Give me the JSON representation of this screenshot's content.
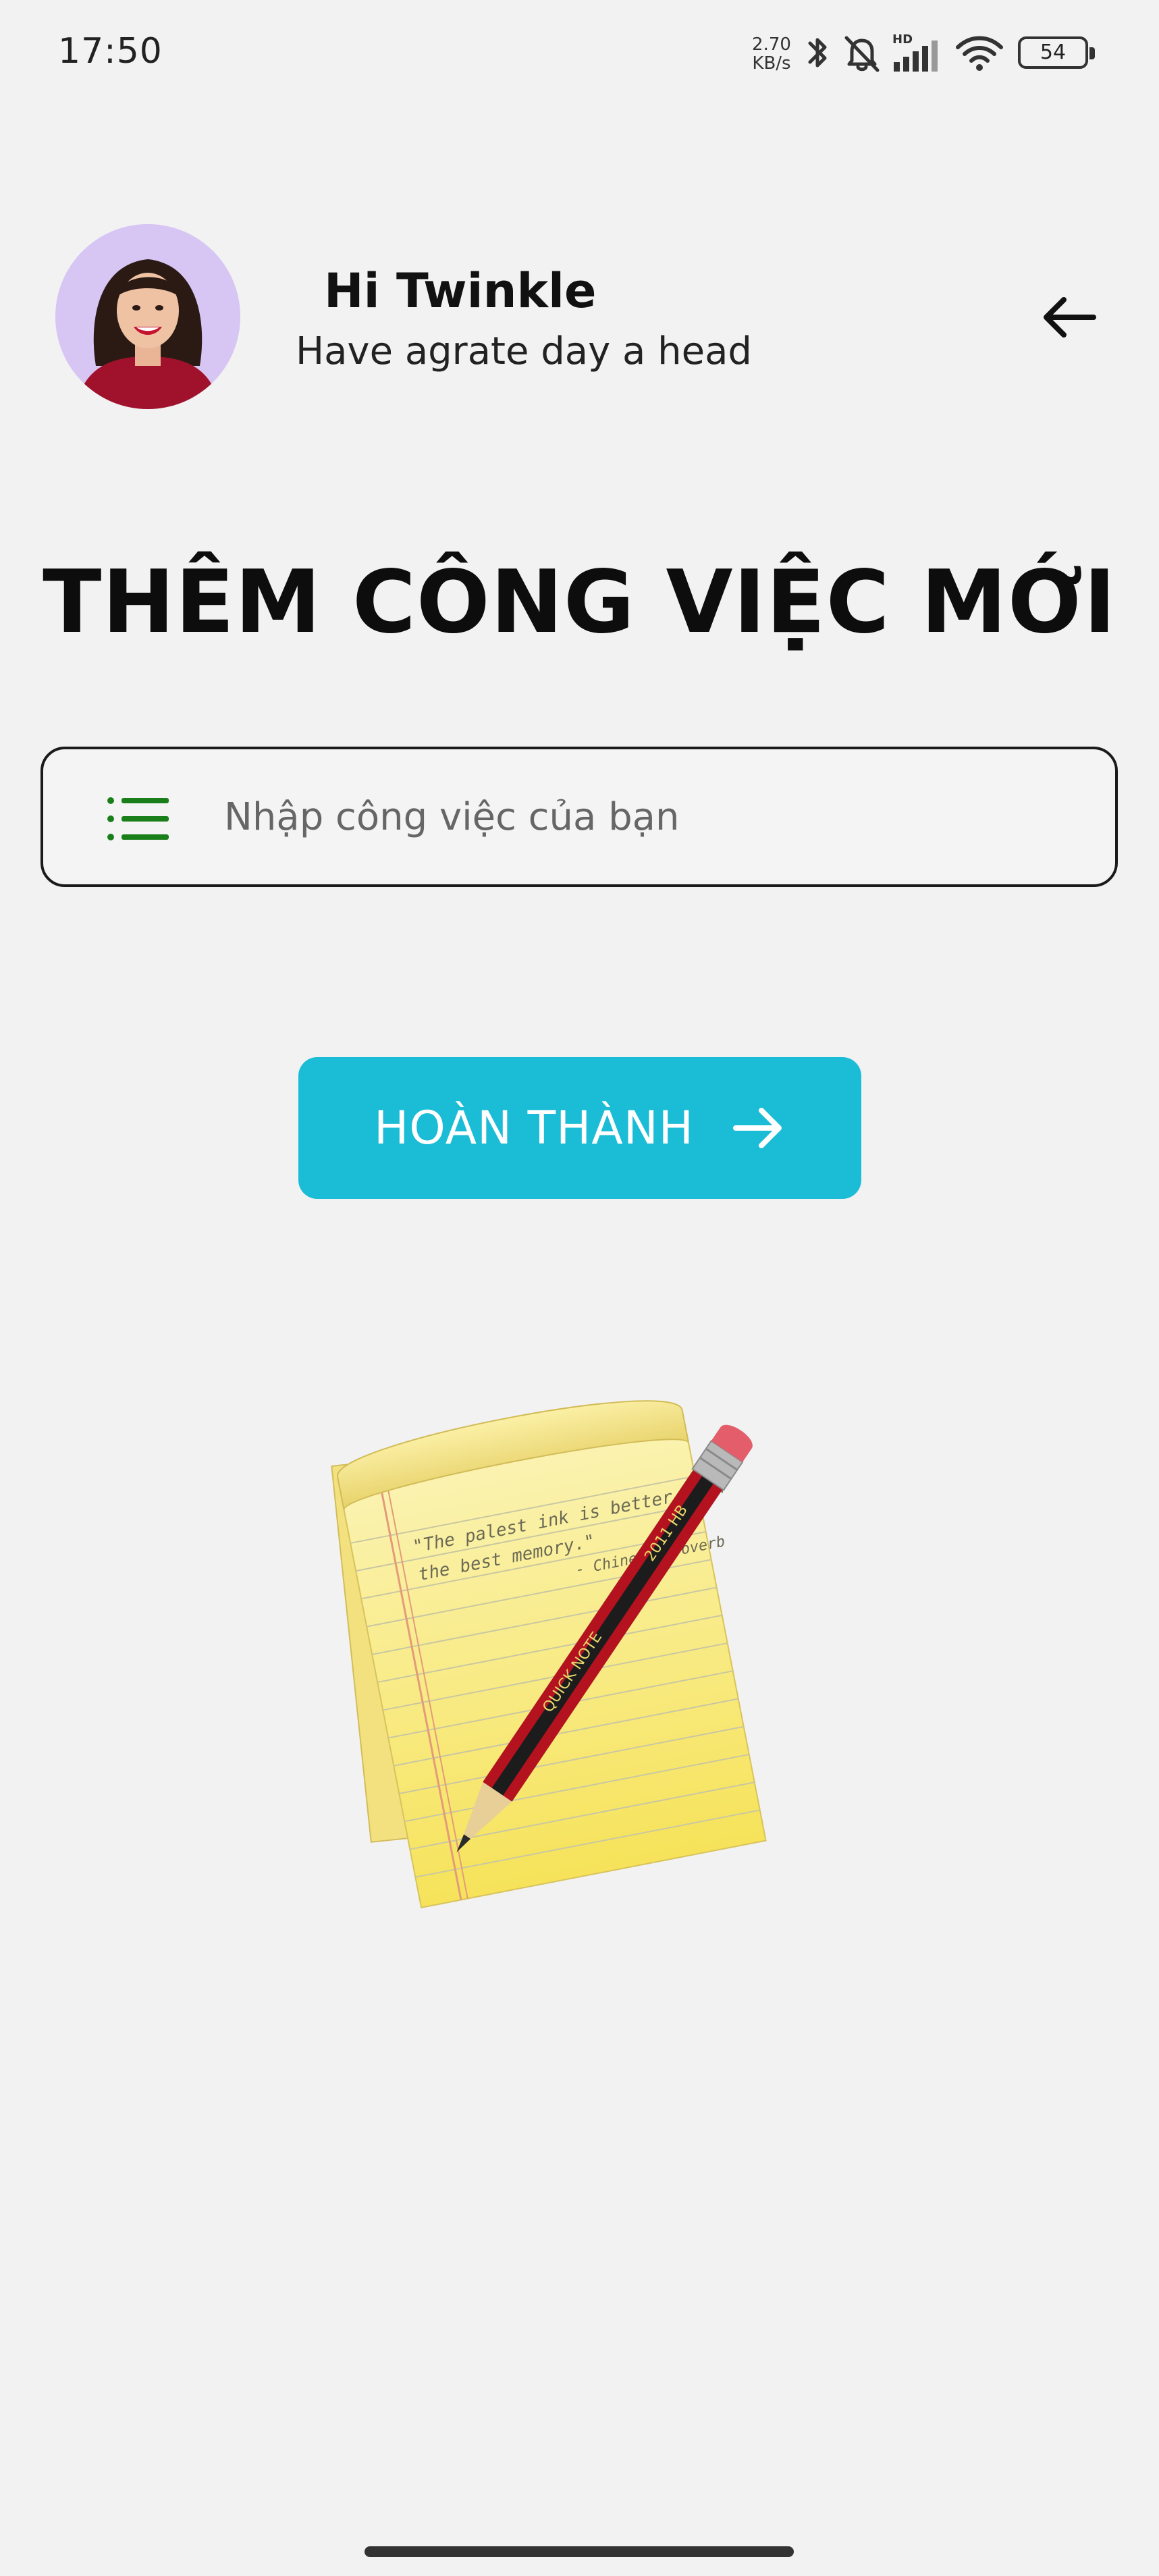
{
  "status_bar": {
    "time": "17:50",
    "net_speed_value": "2.70",
    "net_speed_unit": "KB/s",
    "hd_label": "HD",
    "battery": "54",
    "icons": [
      "bluetooth-icon",
      "bell-muted-icon",
      "signal-icon",
      "wifi-icon",
      "battery-icon"
    ]
  },
  "header": {
    "greeting": "Hi Twinkle",
    "subtitle": "Have agrate day a head",
    "back_icon": "arrow-left-icon"
  },
  "page": {
    "title": "THÊM CÔNG VIỆC MỚI"
  },
  "task_input": {
    "placeholder": "Nhập công việc của bạn",
    "value": "",
    "icon": "list-icon",
    "icon_color": "#1a7f1a"
  },
  "done_button": {
    "label": "HOÀN THÀNH",
    "icon": "arrow-right-icon",
    "color": "#1bbcd6"
  },
  "illustration": {
    "quote_line1": "\"The palest ink is better than",
    "quote_line2": "the best memory.\"",
    "quote_author": "- Chinese Proverb",
    "pencil_brand": "QUICK NOTE",
    "pencil_grade": "2011 HB"
  }
}
